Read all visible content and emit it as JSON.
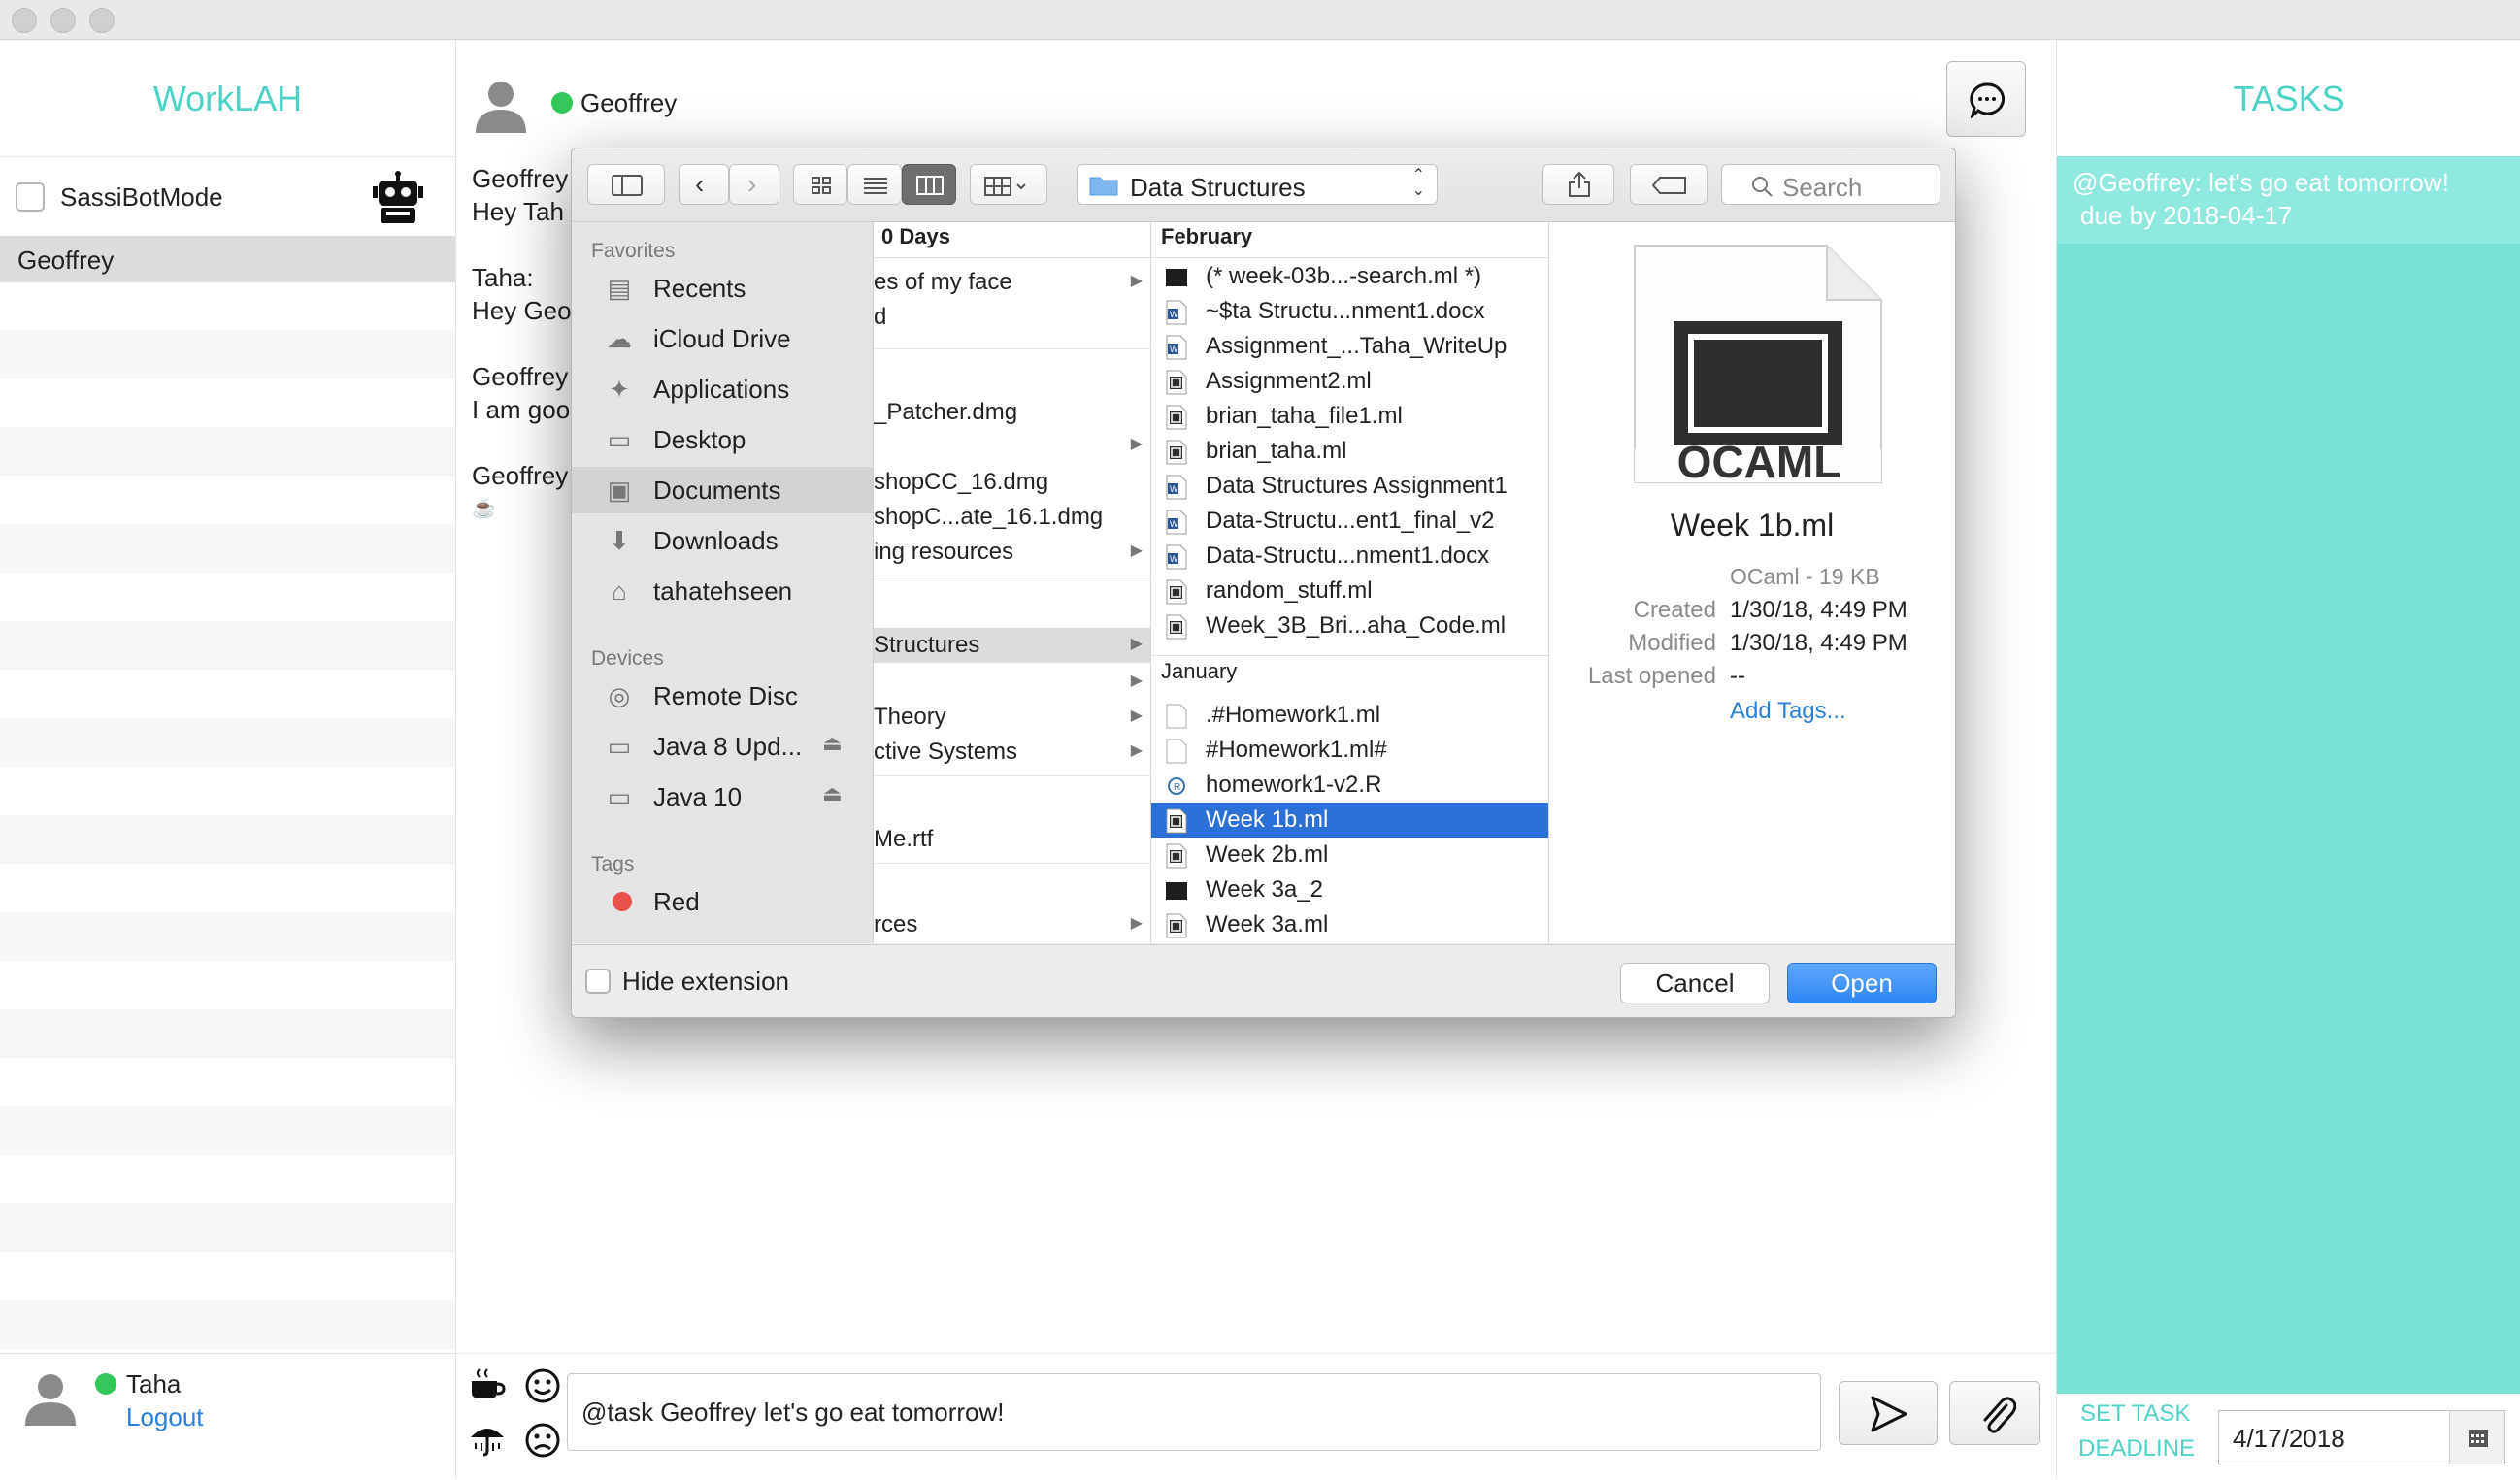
{
  "app": {
    "name": "WorkLAH",
    "tasks_title": "TASKS"
  },
  "sidebar": {
    "bot_mode_label": "SassiBotMode",
    "contacts": [
      "Geoffrey"
    ],
    "current_user": "Taha",
    "logout_label": "Logout"
  },
  "chat": {
    "contact_name": "Geoffrey",
    "messages": [
      {
        "sender": "Geoffrey",
        "text": "Hey Tah"
      },
      {
        "sender": "Taha:",
        "text": "Hey Geo"
      },
      {
        "sender": "Geoffrey",
        "text": "I am goo"
      },
      {
        "sender": "Geoffrey",
        "text": "☕"
      }
    ],
    "input_value": "@task Geoffrey let's go eat tomorrow!"
  },
  "tasks": {
    "items": [
      {
        "text": "@Geoffrey: let's go eat tomorrow!",
        "due": "due by 2018-04-17"
      }
    ],
    "deadline_label_1": "SET TASK",
    "deadline_label_2": "DEADLINE",
    "deadline_value": "4/17/2018"
  },
  "dialog": {
    "location": "Data Structures",
    "search_placeholder": "Search",
    "sidebar": {
      "favorites_header": "Favorites",
      "favorites": [
        {
          "label": "Recents",
          "icon": "recents-icon"
        },
        {
          "label": "iCloud Drive",
          "icon": "cloud-icon"
        },
        {
          "label": "Applications",
          "icon": "applications-icon"
        },
        {
          "label": "Desktop",
          "icon": "desktop-icon"
        },
        {
          "label": "Documents",
          "icon": "documents-icon"
        },
        {
          "label": "Downloads",
          "icon": "downloads-icon"
        },
        {
          "label": "tahatehseen",
          "icon": "home-icon"
        }
      ],
      "devices_header": "Devices",
      "devices": [
        {
          "label": "Remote Disc",
          "icon": "disc-icon"
        },
        {
          "label": "Java 8 Upd...",
          "icon": "drive-icon"
        },
        {
          "label": "Java 10",
          "icon": "drive-icon"
        }
      ],
      "tags_header": "Tags",
      "tags": [
        {
          "label": "Red",
          "color": "#e9524a"
        }
      ]
    },
    "column1": {
      "header": "0 Days",
      "rows": [
        {
          "label": "es of my face"
        },
        {
          "label": "d"
        },
        {
          "label": "_Patcher.dmg"
        },
        {
          "label": "shopCC_16.dmg"
        },
        {
          "label": "shopC...ate_16.1.dmg"
        },
        {
          "label": "ing resources"
        },
        {
          "label": "Structures"
        },
        {
          "label": "Theory"
        },
        {
          "label": "ctive Systems"
        },
        {
          "label": "Me.rtf"
        },
        {
          "label": "rces"
        }
      ]
    },
    "column2": {
      "feb_header": "February",
      "feb_files": [
        {
          "name": "(* week-03b...-search.ml *)",
          "kind": "dark"
        },
        {
          "name": "~$ta Structu...nment1.docx",
          "kind": "word"
        },
        {
          "name": "Assignment_...Taha_WriteUp",
          "kind": "word"
        },
        {
          "name": "Assignment2.ml",
          "kind": "ml"
        },
        {
          "name": "brian_taha_file1.ml",
          "kind": "ml"
        },
        {
          "name": "brian_taha.ml",
          "kind": "ml"
        },
        {
          "name": "Data Structures Assignment1",
          "kind": "word"
        },
        {
          "name": "Data-Structu...ent1_final_v2",
          "kind": "word"
        },
        {
          "name": "Data-Structu...nment1.docx",
          "kind": "word"
        },
        {
          "name": "random_stuff.ml",
          "kind": "ml"
        },
        {
          "name": "Week_3B_Bri...aha_Code.ml",
          "kind": "ml"
        }
      ],
      "jan_header": "January",
      "jan_files": [
        {
          "name": ".#Homework1.ml",
          "kind": "blank"
        },
        {
          "name": "#Homework1.ml#",
          "kind": "blank"
        },
        {
          "name": "homework1-v2.R",
          "kind": "r"
        },
        {
          "name": "Week 1b.ml",
          "kind": "ml"
        },
        {
          "name": "Week 2b.ml",
          "kind": "ml"
        },
        {
          "name": "Week 3a_2",
          "kind": "dark"
        },
        {
          "name": "Week 3a.ml",
          "kind": "ml"
        }
      ],
      "selected": "Week 1b.ml"
    },
    "preview": {
      "icon_label": "OCAML",
      "file_name": "Week 1b.ml",
      "kind_size": "OCaml - 19 KB",
      "created_label": "Created",
      "created_value": "1/30/18, 4:49 PM",
      "modified_label": "Modified",
      "modified_value": "1/30/18, 4:49 PM",
      "last_opened_label": "Last opened",
      "last_opened_value": "--",
      "add_tags_label": "Add Tags..."
    },
    "hide_extension_label": "Hide extension",
    "cancel_label": "Cancel",
    "open_label": "Open"
  },
  "colors": {
    "accent": "#4fd2c6",
    "tasks_bg": "#79e3d6",
    "selection": "#2a70d6",
    "open_button": "#3b8ff5"
  }
}
